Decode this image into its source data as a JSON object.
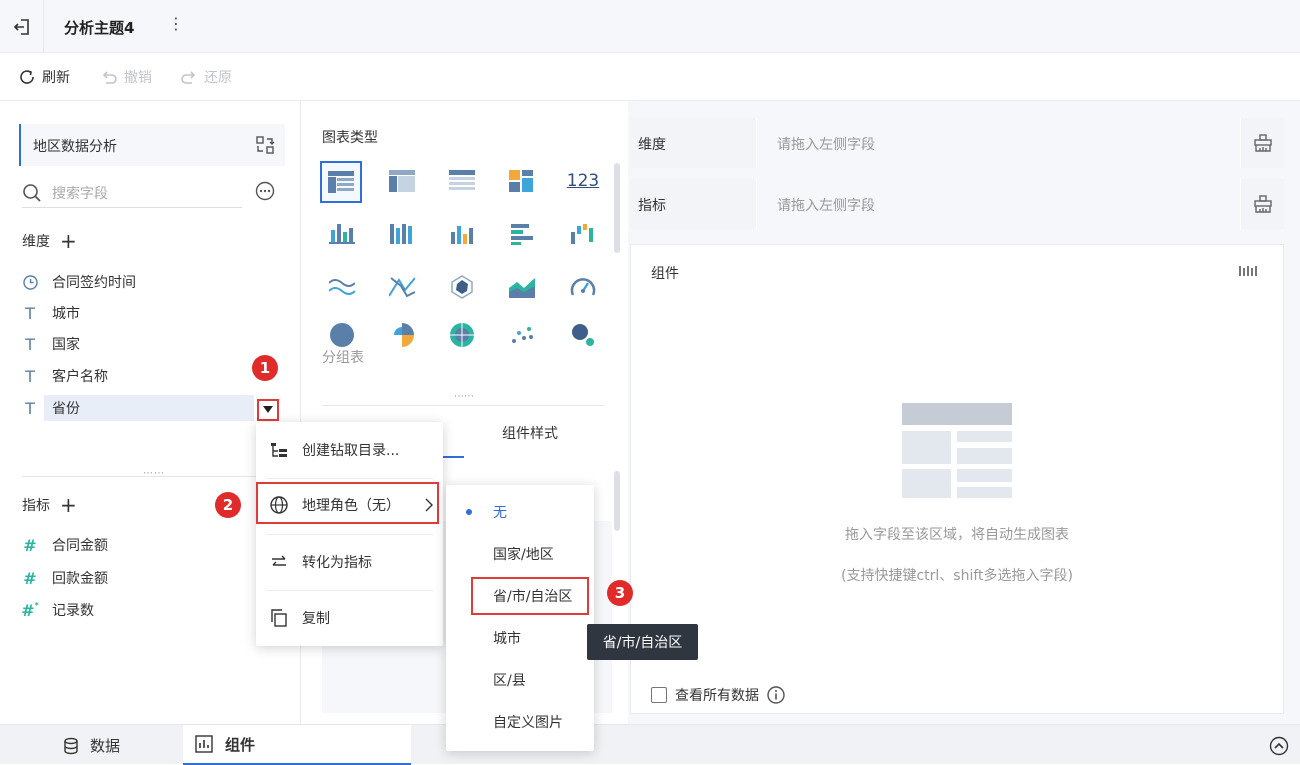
{
  "header": {
    "title": "分析主题4"
  },
  "toolbar": {
    "refresh": "刷新",
    "undo": "撤销",
    "redo": "还原"
  },
  "left": {
    "dataset": "地区数据分析",
    "search_placeholder": "搜索字段",
    "dimension_title": "维度",
    "dimensions": [
      "合同签约时间",
      "城市",
      "国家",
      "客户名称",
      "省份"
    ],
    "measure_title": "指标",
    "measures": [
      "合同金额",
      "回款金额",
      "记录数"
    ]
  },
  "middle": {
    "chart_type_title": "图表类型",
    "chart_icon_text": "123",
    "group_table_label": "分组表",
    "tab_style": "组件样式"
  },
  "right": {
    "dimension_shelf": "维度",
    "measure_shelf": "指标",
    "shelf_placeholder": "请拖入左侧字段",
    "component_title": "组件",
    "hint1": "拖入字段至该区域，将自动生成图表",
    "hint2": "(支持快捷键ctrl、shift多选拖入字段)",
    "view_all": "查看所有数据"
  },
  "bottom_tabs": {
    "data": "数据",
    "component": "组件"
  },
  "context_menu": {
    "items": [
      "创建钻取目录...",
      "地理角色（无）",
      "转化为指标",
      "复制"
    ]
  },
  "submenu": {
    "items": [
      "无",
      "国家/地区",
      "省/市/自治区",
      "城市",
      "区/县",
      "自定义图片"
    ]
  },
  "tooltip": "省/市/自治区",
  "badges": [
    "1",
    "2",
    "3"
  ],
  "colors": {
    "accent": "#2f6fd6",
    "highlight": "#e03b3b",
    "measure": "#2bb5a0"
  }
}
